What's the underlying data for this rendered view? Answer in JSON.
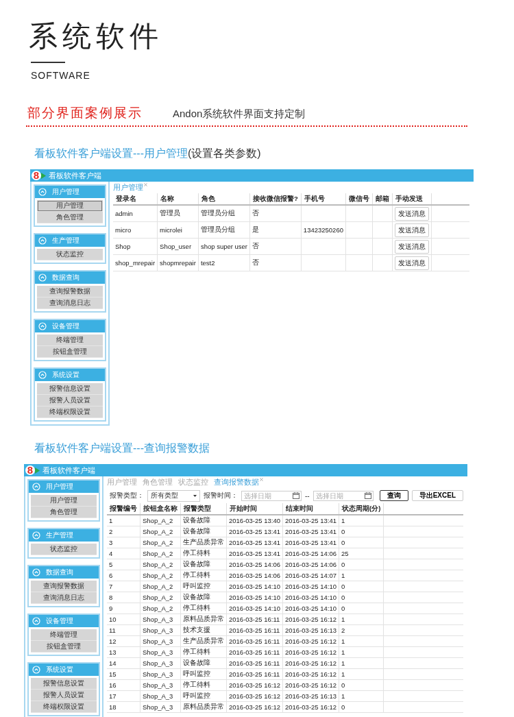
{
  "header": {
    "title": "系统软件",
    "subtitle": "SOFTWARE"
  },
  "section": {
    "heading": "部分界面案例展示",
    "note": "Andon系统软件界面支持定制"
  },
  "showcases": [
    {
      "caption": "看板软件客户端设置---用户管理",
      "caption_suffix": "(设置各类参数)",
      "window": {
        "logo_mark": "8",
        "title": "看板软件客户端"
      },
      "sidebar": [
        {
          "title": "用户管理",
          "expanded": true,
          "items": [
            {
              "label": "用户管理",
              "selected": true
            },
            {
              "label": "角色管理",
              "selected": false
            }
          ]
        },
        {
          "title": "生产管理",
          "expanded": true,
          "items": [
            {
              "label": "状态监控",
              "selected": false
            }
          ]
        },
        {
          "title": "数据查询",
          "expanded": true,
          "items": [
            {
              "label": "查询报警数据",
              "selected": false
            },
            {
              "label": "查询消息日志",
              "selected": false
            }
          ]
        },
        {
          "title": "设备管理",
          "expanded": true,
          "items": [
            {
              "label": "终端管理",
              "selected": false
            },
            {
              "label": "按钮盒管理",
              "selected": false
            }
          ]
        },
        {
          "title": "系统设置",
          "expanded": true,
          "items": [
            {
              "label": "报警信息设置",
              "selected": false
            },
            {
              "label": "报警人员设置",
              "selected": false
            },
            {
              "label": "终端权限设置",
              "selected": false
            }
          ]
        }
      ],
      "tabs": [
        {
          "label": "用户管理",
          "selected": true,
          "closable": true
        }
      ],
      "table": {
        "columns": [
          {
            "label": "登录名",
            "kind": "text"
          },
          {
            "label": "名称",
            "kind": "text"
          },
          {
            "label": "角色",
            "kind": "text"
          },
          {
            "label": "接收微信报警?",
            "kind": "text"
          },
          {
            "label": "手机号",
            "kind": "text"
          },
          {
            "label": "微信号",
            "kind": "text"
          },
          {
            "label": "邮箱",
            "kind": "text"
          },
          {
            "label": "手动发送",
            "kind": "button"
          }
        ],
        "rows": [
          [
            "admin",
            "管理员",
            "管理员分组",
            "否",
            "",
            "",
            "",
            "发送消息"
          ],
          [
            "micro",
            "microlei",
            "管理员分组",
            "是",
            "13423250260",
            "",
            "",
            "发送消息"
          ],
          [
            "Shop",
            "Shop_user",
            "shop super user",
            "否",
            "",
            "",
            "",
            "发送消息"
          ],
          [
            "shop_mrepair",
            "shopmrepair",
            "test2",
            "否",
            "",
            "",
            "",
            "发送消息"
          ]
        ]
      }
    },
    {
      "caption": "看板软件客户端设置---查询报警数据",
      "window": {
        "logo_mark": "8",
        "title": "看板软件客户端"
      },
      "sidebar": [
        {
          "title": "用户管理",
          "expanded": true,
          "items": [
            {
              "label": "用户管理",
              "selected": false
            },
            {
              "label": "角色管理",
              "selected": false
            }
          ]
        },
        {
          "title": "生产管理",
          "expanded": true,
          "items": [
            {
              "label": "状态监控",
              "selected": false
            }
          ]
        },
        {
          "title": "数据查询",
          "expanded": true,
          "items": [
            {
              "label": "查询报警数据",
              "selected": false
            },
            {
              "label": "查询消息日志",
              "selected": false
            }
          ]
        },
        {
          "title": "设备管理",
          "expanded": true,
          "items": [
            {
              "label": "终端管理",
              "selected": false
            },
            {
              "label": "按钮盒管理",
              "selected": false
            }
          ]
        },
        {
          "title": "系统设置",
          "expanded": true,
          "items": [
            {
              "label": "报警信息设置",
              "selected": false
            },
            {
              "label": "报警人员设置",
              "selected": false
            },
            {
              "label": "终端权限设置",
              "selected": false
            }
          ]
        }
      ],
      "tabs": [
        {
          "label": "用户管理",
          "selected": false,
          "closable": false
        },
        {
          "label": "角色管理",
          "selected": false,
          "closable": false
        },
        {
          "label": "状态监控",
          "selected": false,
          "closable": false
        },
        {
          "label": "查询报警数据",
          "selected": true,
          "closable": true
        }
      ],
      "filters": {
        "type_label": "报警类型：",
        "type_value": "所有类型",
        "time_label": "报警时间：",
        "from_placeholder": "选择日期",
        "separator": "--",
        "to_placeholder": "选择日期",
        "buttons": [
          {
            "label": "查询",
            "primary": true
          },
          {
            "label": "导出EXCEL",
            "primary": false
          }
        ]
      },
      "table": {
        "columns": [
          {
            "label": "报警编号",
            "kind": "text"
          },
          {
            "label": "按钮盒名称",
            "kind": "text"
          },
          {
            "label": "报警类型",
            "kind": "text"
          },
          {
            "label": "开始时间",
            "kind": "text"
          },
          {
            "label": "结束时间",
            "kind": "text"
          },
          {
            "label": "状态周期(分)",
            "kind": "text"
          }
        ],
        "rows": [
          [
            "1",
            "Shop_A_2",
            "设备故障",
            "2016-03-25 13:40",
            "2016-03-25 13:41",
            "1"
          ],
          [
            "2",
            "Shop_A_2",
            "设备故障",
            "2016-03-25 13:41",
            "2016-03-25 13:41",
            "0"
          ],
          [
            "3",
            "Shop_A_2",
            "生产品质异常",
            "2016-03-25 13:41",
            "2016-03-25 13:41",
            "0"
          ],
          [
            "4",
            "Shop_A_2",
            "停工待料",
            "2016-03-25 13:41",
            "2016-03-25 14:06",
            "25"
          ],
          [
            "5",
            "Shop_A_2",
            "设备故障",
            "2016-03-25 14:06",
            "2016-03-25 14:06",
            "0"
          ],
          [
            "6",
            "Shop_A_2",
            "停工待料",
            "2016-03-25 14:06",
            "2016-03-25 14:07",
            "1"
          ],
          [
            "7",
            "Shop_A_2",
            "呼叫监控",
            "2016-03-25 14:10",
            "2016-03-25 14:10",
            "0"
          ],
          [
            "8",
            "Shop_A_2",
            "设备故障",
            "2016-03-25 14:10",
            "2016-03-25 14:10",
            "0"
          ],
          [
            "9",
            "Shop_A_2",
            "停工待料",
            "2016-03-25 14:10",
            "2016-03-25 14:10",
            "0"
          ],
          [
            "10",
            "Shop_A_3",
            "原料品质异常",
            "2016-03-25 16:11",
            "2016-03-25 16:12",
            "1"
          ],
          [
            "11",
            "Shop_A_3",
            "技术支援",
            "2016-03-25 16:11",
            "2016-03-25 16:13",
            "2"
          ],
          [
            "12",
            "Shop_A_3",
            "生产品质异常",
            "2016-03-25 16:11",
            "2016-03-25 16:12",
            "1"
          ],
          [
            "13",
            "Shop_A_3",
            "停工待料",
            "2016-03-25 16:11",
            "2016-03-25 16:12",
            "1"
          ],
          [
            "14",
            "Shop_A_3",
            "设备故障",
            "2016-03-25 16:11",
            "2016-03-25 16:12",
            "1"
          ],
          [
            "15",
            "Shop_A_3",
            "呼叫监控",
            "2016-03-25 16:11",
            "2016-03-25 16:12",
            "1"
          ],
          [
            "16",
            "Shop_A_3",
            "停工待料",
            "2016-03-25 16:12",
            "2016-03-25 16:12",
            "0"
          ],
          [
            "17",
            "Shop_A_3",
            "呼叫监控",
            "2016-03-25 16:12",
            "2016-03-25 16:13",
            "1"
          ],
          [
            "18",
            "Shop_A_3",
            "原料品质异常",
            "2016-03-25 16:12",
            "2016-03-25 16:12",
            "0"
          ]
        ]
      }
    }
  ]
}
